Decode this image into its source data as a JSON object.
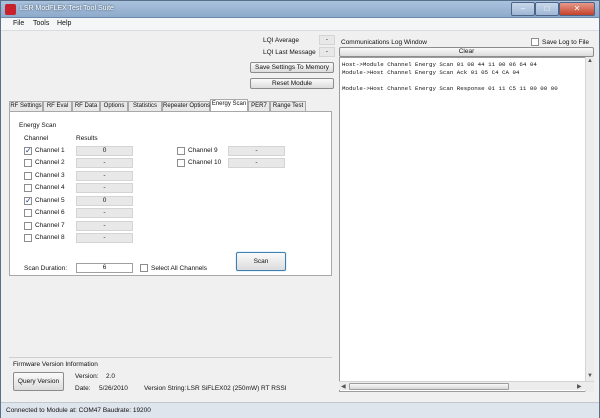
{
  "window": {
    "title": "LSR ModFLEX Test Tool Suite"
  },
  "menu": [
    "File",
    "Tools",
    "Help"
  ],
  "top": {
    "lqi_average_label": "LQI Average",
    "lqi_average_value": "-",
    "lqi_last_message_label": "LQI Last Message",
    "lqi_last_message_value": "-",
    "save_settings_label": "Save Settings To Memory",
    "reset_module_label": "Reset Module"
  },
  "tabs": [
    "RF Settings",
    "RF Eval",
    "RF Data",
    "Options",
    "Statistics",
    "Repeater Options",
    "Energy Scan",
    "PER7",
    "Range Test"
  ],
  "active_tab": "Energy Scan",
  "energy_scan": {
    "group_label": "Energy Scan",
    "channel_header": "Channel",
    "results_header": "Results",
    "channels_left": [
      {
        "label": "Channel 1",
        "checked": true,
        "result": "0"
      },
      {
        "label": "Channel 2",
        "checked": false,
        "result": "-"
      },
      {
        "label": "Channel 3",
        "checked": false,
        "result": "-"
      },
      {
        "label": "Channel 4",
        "checked": false,
        "result": "-"
      },
      {
        "label": "Channel 5",
        "checked": true,
        "result": "0"
      },
      {
        "label": "Channel 6",
        "checked": false,
        "result": "-"
      },
      {
        "label": "Channel 7",
        "checked": false,
        "result": "-"
      },
      {
        "label": "Channel 8",
        "checked": false,
        "result": "-"
      }
    ],
    "channels_right": [
      {
        "label": "Channel 9",
        "checked": false,
        "result": "-"
      },
      {
        "label": "Channel 10",
        "checked": false,
        "result": "-"
      }
    ],
    "scan_duration_label": "Scan Duration:",
    "scan_duration_value": "6",
    "select_all_label": "Select All Channels",
    "scan_button_label": "Scan"
  },
  "firmware": {
    "group_label": "Firmware Version Information",
    "query_button_label": "Query Version",
    "version_label": "Version:",
    "version_value": "2.0",
    "date_label": "Date:",
    "date_value": "5/26/2010",
    "version_string_label": "Version String:",
    "version_string_value": "LSR SiFLEX02 (250mW) RT RSSI"
  },
  "log": {
    "title": "Communications Log Window",
    "save_log_label": "Save Log to File",
    "clear_label": "Clear",
    "lines": [
      "Host->Module Channel Energy Scan 01 08 44 11 00 06 64 04",
      "Module->Host Channel Energy Scan Ack 01 05 C4 CA 04",
      "",
      "Module->Host Channel Energy Scan Response 01 11 C5 11 00 00 00"
    ]
  },
  "status": {
    "text": "Connected to Module at: COM47 Baudrate: 19200"
  },
  "colors": {
    "titlebar": "#9db7d6",
    "close_button": "#c5412b",
    "window_bg": "#f0f0f0"
  }
}
